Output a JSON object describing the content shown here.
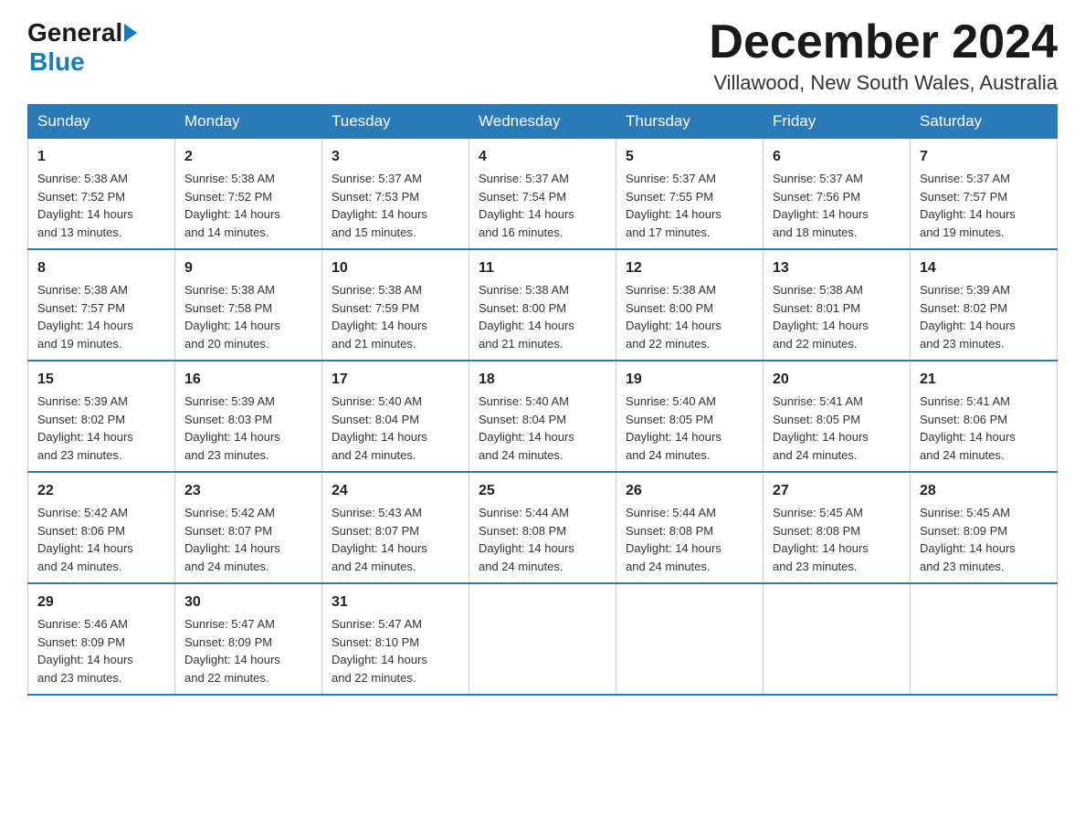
{
  "header": {
    "logo_general": "General",
    "logo_blue": "Blue",
    "month_title": "December 2024",
    "location": "Villawood, New South Wales, Australia"
  },
  "weekdays": [
    "Sunday",
    "Monday",
    "Tuesday",
    "Wednesday",
    "Thursday",
    "Friday",
    "Saturday"
  ],
  "weeks": [
    [
      {
        "day": "1",
        "sunrise": "5:38 AM",
        "sunset": "7:52 PM",
        "daylight": "14 hours and 13 minutes."
      },
      {
        "day": "2",
        "sunrise": "5:38 AM",
        "sunset": "7:52 PM",
        "daylight": "14 hours and 14 minutes."
      },
      {
        "day": "3",
        "sunrise": "5:37 AM",
        "sunset": "7:53 PM",
        "daylight": "14 hours and 15 minutes."
      },
      {
        "day": "4",
        "sunrise": "5:37 AM",
        "sunset": "7:54 PM",
        "daylight": "14 hours and 16 minutes."
      },
      {
        "day": "5",
        "sunrise": "5:37 AM",
        "sunset": "7:55 PM",
        "daylight": "14 hours and 17 minutes."
      },
      {
        "day": "6",
        "sunrise": "5:37 AM",
        "sunset": "7:56 PM",
        "daylight": "14 hours and 18 minutes."
      },
      {
        "day": "7",
        "sunrise": "5:37 AM",
        "sunset": "7:57 PM",
        "daylight": "14 hours and 19 minutes."
      }
    ],
    [
      {
        "day": "8",
        "sunrise": "5:38 AM",
        "sunset": "7:57 PM",
        "daylight": "14 hours and 19 minutes."
      },
      {
        "day": "9",
        "sunrise": "5:38 AM",
        "sunset": "7:58 PM",
        "daylight": "14 hours and 20 minutes."
      },
      {
        "day": "10",
        "sunrise": "5:38 AM",
        "sunset": "7:59 PM",
        "daylight": "14 hours and 21 minutes."
      },
      {
        "day": "11",
        "sunrise": "5:38 AM",
        "sunset": "8:00 PM",
        "daylight": "14 hours and 21 minutes."
      },
      {
        "day": "12",
        "sunrise": "5:38 AM",
        "sunset": "8:00 PM",
        "daylight": "14 hours and 22 minutes."
      },
      {
        "day": "13",
        "sunrise": "5:38 AM",
        "sunset": "8:01 PM",
        "daylight": "14 hours and 22 minutes."
      },
      {
        "day": "14",
        "sunrise": "5:39 AM",
        "sunset": "8:02 PM",
        "daylight": "14 hours and 23 minutes."
      }
    ],
    [
      {
        "day": "15",
        "sunrise": "5:39 AM",
        "sunset": "8:02 PM",
        "daylight": "14 hours and 23 minutes."
      },
      {
        "day": "16",
        "sunrise": "5:39 AM",
        "sunset": "8:03 PM",
        "daylight": "14 hours and 23 minutes."
      },
      {
        "day": "17",
        "sunrise": "5:40 AM",
        "sunset": "8:04 PM",
        "daylight": "14 hours and 24 minutes."
      },
      {
        "day": "18",
        "sunrise": "5:40 AM",
        "sunset": "8:04 PM",
        "daylight": "14 hours and 24 minutes."
      },
      {
        "day": "19",
        "sunrise": "5:40 AM",
        "sunset": "8:05 PM",
        "daylight": "14 hours and 24 minutes."
      },
      {
        "day": "20",
        "sunrise": "5:41 AM",
        "sunset": "8:05 PM",
        "daylight": "14 hours and 24 minutes."
      },
      {
        "day": "21",
        "sunrise": "5:41 AM",
        "sunset": "8:06 PM",
        "daylight": "14 hours and 24 minutes."
      }
    ],
    [
      {
        "day": "22",
        "sunrise": "5:42 AM",
        "sunset": "8:06 PM",
        "daylight": "14 hours and 24 minutes."
      },
      {
        "day": "23",
        "sunrise": "5:42 AM",
        "sunset": "8:07 PM",
        "daylight": "14 hours and 24 minutes."
      },
      {
        "day": "24",
        "sunrise": "5:43 AM",
        "sunset": "8:07 PM",
        "daylight": "14 hours and 24 minutes."
      },
      {
        "day": "25",
        "sunrise": "5:44 AM",
        "sunset": "8:08 PM",
        "daylight": "14 hours and 24 minutes."
      },
      {
        "day": "26",
        "sunrise": "5:44 AM",
        "sunset": "8:08 PM",
        "daylight": "14 hours and 24 minutes."
      },
      {
        "day": "27",
        "sunrise": "5:45 AM",
        "sunset": "8:08 PM",
        "daylight": "14 hours and 23 minutes."
      },
      {
        "day": "28",
        "sunrise": "5:45 AM",
        "sunset": "8:09 PM",
        "daylight": "14 hours and 23 minutes."
      }
    ],
    [
      {
        "day": "29",
        "sunrise": "5:46 AM",
        "sunset": "8:09 PM",
        "daylight": "14 hours and 23 minutes."
      },
      {
        "day": "30",
        "sunrise": "5:47 AM",
        "sunset": "8:09 PM",
        "daylight": "14 hours and 22 minutes."
      },
      {
        "day": "31",
        "sunrise": "5:47 AM",
        "sunset": "8:10 PM",
        "daylight": "14 hours and 22 minutes."
      },
      null,
      null,
      null,
      null
    ]
  ],
  "labels": {
    "sunrise": "Sunrise:",
    "sunset": "Sunset:",
    "daylight": "Daylight:"
  }
}
